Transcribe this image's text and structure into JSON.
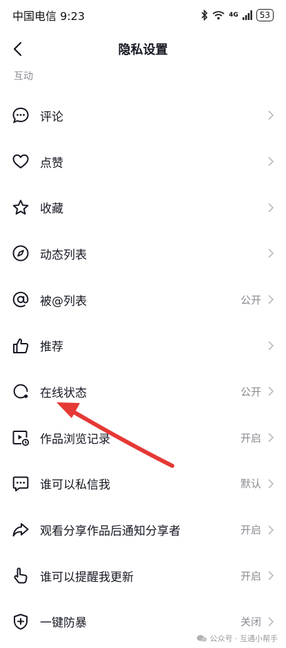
{
  "status_bar": {
    "carrier_time": "中国电信 9:23",
    "network": "4G",
    "battery": "53"
  },
  "header": {
    "title": "隐私设置"
  },
  "section": {
    "label": "互动"
  },
  "rows": [
    {
      "label": "评论",
      "value": "",
      "icon": "comment-icon"
    },
    {
      "label": "点赞",
      "value": "",
      "icon": "heart-icon"
    },
    {
      "label": "收藏",
      "value": "",
      "icon": "star-icon"
    },
    {
      "label": "动态列表",
      "value": "",
      "icon": "compass-icon"
    },
    {
      "label": "被@列表",
      "value": "公开",
      "icon": "at-icon"
    },
    {
      "label": "推荐",
      "value": "",
      "icon": "thumbs-up-icon"
    },
    {
      "label": "在线状态",
      "value": "公开",
      "icon": "online-status-icon"
    },
    {
      "label": "作品浏览记录",
      "value": "开启",
      "icon": "video-history-icon"
    },
    {
      "label": "谁可以私信我",
      "value": "默认",
      "icon": "message-icon"
    },
    {
      "label": "观看分享作品后通知分享者",
      "value": "开启",
      "icon": "share-icon"
    },
    {
      "label": "谁可以提醒我更新",
      "value": "开启",
      "icon": "tap-hand-icon"
    },
    {
      "label": "一键防暴",
      "value": "关闭",
      "icon": "shield-plus-icon"
    }
  ],
  "watermark": {
    "text": "公众号 · 互通小帮手"
  },
  "colors": {
    "annotation_arrow": "#e53935",
    "secondary_text": "#8a8b91"
  }
}
